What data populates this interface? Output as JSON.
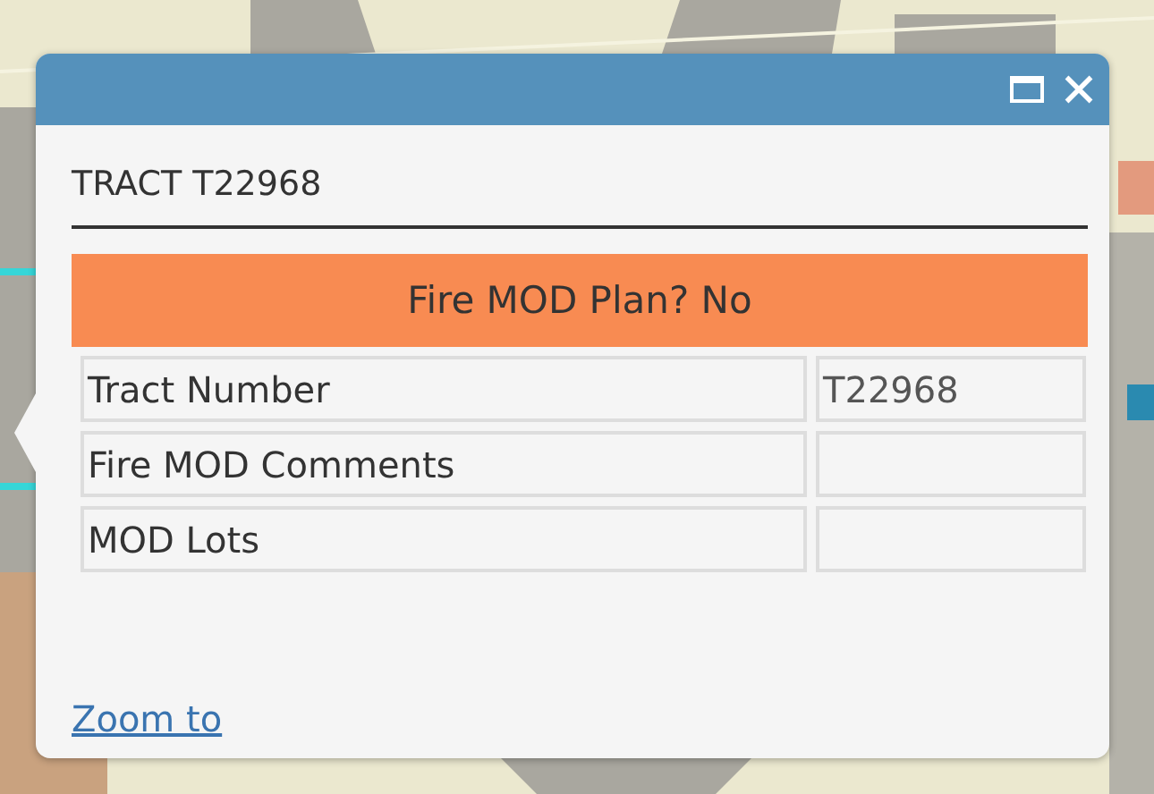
{
  "popup": {
    "title": "TRACT T22968",
    "banner": "Fire MOD Plan? No",
    "rows": [
      {
        "label": "Tract Number",
        "value": "T22968"
      },
      {
        "label": "Fire MOD Comments"
      },
      {
        "label": "MOD Lots"
      }
    ],
    "link": "Zoom to"
  }
}
